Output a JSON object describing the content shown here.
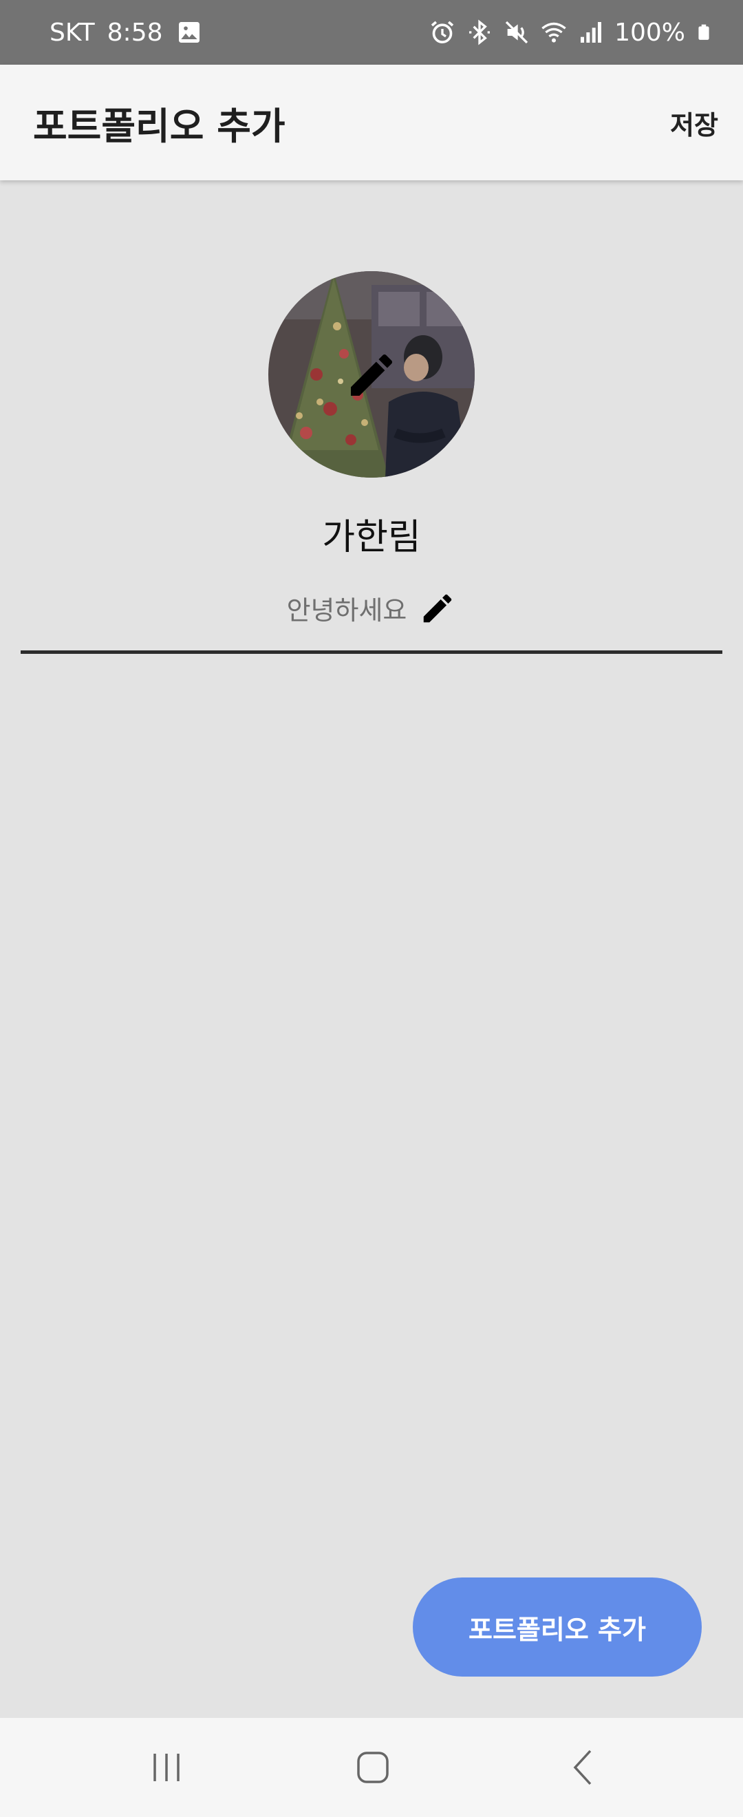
{
  "status_bar": {
    "carrier": "SKT",
    "time": "8:58",
    "battery": "100%",
    "icons": [
      "gallery-icon",
      "alarm-icon",
      "bluetooth-icon",
      "mute-icon",
      "wifi-icon",
      "signal-icon",
      "battery-icon"
    ]
  },
  "app_bar": {
    "title": "포트폴리오 추가",
    "save_label": "저장"
  },
  "profile": {
    "name": "가한림",
    "bio": "안녕하세요",
    "avatar_icon": "edit-pencil-icon"
  },
  "fab": {
    "label": "포트폴리오 추가"
  },
  "nav_bar": {
    "icons": [
      "recent-apps-icon",
      "home-icon",
      "back-icon"
    ]
  },
  "colors": {
    "background": "#e3e3e3",
    "status_bar": "#737373",
    "app_bar": "#f5f5f5",
    "fab": "#628de9",
    "divider": "#2c2c2c"
  }
}
